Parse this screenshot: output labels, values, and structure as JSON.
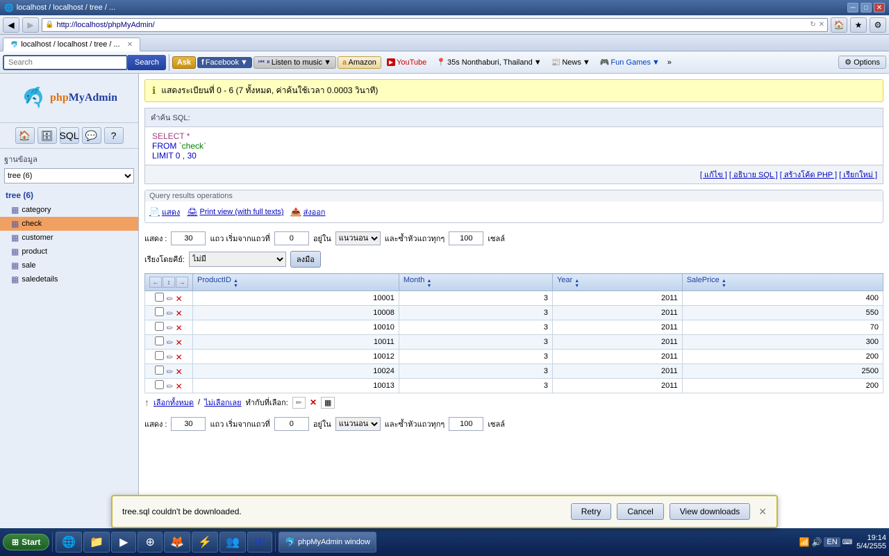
{
  "browser": {
    "title": "localhost / localhost / tree / ...",
    "address": "http://localhost/phpMyAdmin/",
    "tab1_label": "localhost / localhost / tree / ...",
    "tab1_icon": "PMA"
  },
  "toolbar": {
    "search_placeholder": "Search",
    "search_label": "Search",
    "ask_label": "Ask",
    "facebook_label": "Facebook",
    "music_label": "Listen to music",
    "amazon_label": "Amazon",
    "youtube_label": "YouTube",
    "location_label": "35s Nonthaburi, Thailand",
    "news_label": "News",
    "games_label": "Fun Games",
    "options_label": "Options"
  },
  "sidebar": {
    "db_label": "ฐานข้อมูล",
    "db_selected": "tree (6)",
    "tree_label": "tree (6)",
    "items": [
      {
        "name": "category",
        "label": "category"
      },
      {
        "name": "check",
        "label": "check",
        "active": true
      },
      {
        "name": "customer",
        "label": "customer"
      },
      {
        "name": "product",
        "label": "product"
      },
      {
        "name": "sale",
        "label": "sale"
      },
      {
        "name": "saledetails",
        "label": "saledetails"
      }
    ]
  },
  "content": {
    "info_msg": "แสดงระเบียนที่ 0 - 6 (7 ทั้งหมด, ค่าค้นใช้เวลา 0.0003 วินาที)",
    "sql_header": "คำค้น SQL:",
    "sql_select": "SELECT *",
    "sql_from": "FROM",
    "sql_table": "`check`",
    "sql_limit": "LIMIT 0 , 30",
    "sql_edit": "[ แก้ไข ]",
    "sql_explain": "[ อธิบาย SQL ]",
    "sql_create_php": "[ สร้างโค้ด PHP ]",
    "sql_reload": "[ เรียกใหม่ ]",
    "query_ops_header": "Query results operations",
    "op_show": "แสดง",
    "op_print": "Print view (with full texts)",
    "op_export": "ส่งออก",
    "show_label": "แสดง :",
    "show_value": "30",
    "from_label": "แถว เริ่มจากแถวที่",
    "from_value": "0",
    "in_label": "อยู่ใน",
    "in_select": "แนวนอน",
    "repeat_label": "และซ้ำหัวแถวทุกๆ",
    "repeat_value": "100",
    "cell_label": "เซลล์",
    "sort_label": "เรียงโดยคีย์:",
    "sort_select": "ไม่มี",
    "go_btn": "ลงมือ",
    "col_headers": [
      "←↕→",
      "ProductID",
      "Month",
      "Year",
      "SalePrice"
    ],
    "rows": [
      {
        "id": 1,
        "pid": "10001",
        "month": "3",
        "year": "2011",
        "price": "400"
      },
      {
        "id": 2,
        "pid": "10008",
        "month": "3",
        "year": "2011",
        "price": "550"
      },
      {
        "id": 3,
        "pid": "10010",
        "month": "3",
        "year": "2011",
        "price": "70"
      },
      {
        "id": 4,
        "pid": "10011",
        "month": "3",
        "year": "2011",
        "price": "300"
      },
      {
        "id": 5,
        "pid": "10012",
        "month": "3",
        "year": "2011",
        "price": "200"
      },
      {
        "id": 6,
        "pid": "10024",
        "month": "3",
        "year": "2011",
        "price": "2500"
      },
      {
        "id": 7,
        "pid": "10013",
        "month": "3",
        "year": "2011",
        "price": "200"
      }
    ],
    "select_all": "เลือกทั้งหมด",
    "select_none": "ไม่เลือกเลย",
    "with_selected": "ทำกับที่เลือก:",
    "bottom_show_label": "แสดง :",
    "bottom_show_value": "30",
    "bottom_from_label": "แถว เริ่มจากแถวที่",
    "bottom_from_value": "0",
    "bottom_in_label": "อยู่ใน",
    "bottom_in_select": "แนวนอน",
    "bottom_repeat_label": "และซ้ำหัวแถวทุกๆ",
    "bottom_repeat_value": "100",
    "bottom_cell_label": "เซลล์"
  },
  "download_bar": {
    "message": "tree.sql couldn't be downloaded.",
    "retry_label": "Retry",
    "cancel_label": "Cancel",
    "view_downloads_label": "View downloads"
  },
  "taskbar": {
    "start_label": "Start",
    "items": [
      {
        "label": "phpMyAdmin window",
        "active": true
      }
    ],
    "lang": "EN",
    "time": "19:14",
    "date": "5/4/2555"
  }
}
